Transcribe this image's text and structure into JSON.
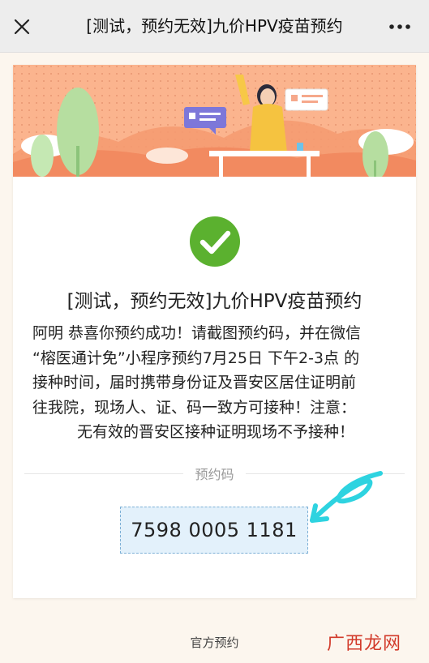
{
  "header": {
    "title": "[测试，预约无效]九价HPV疫苗预约",
    "close_icon": "close-icon",
    "more_icon": "more-dots-icon"
  },
  "card": {
    "heading": "[测试，预约无效]九价HPV疫苗预约",
    "message_lines": [
      "阿明 恭喜你预约成功！请截图预约码，并在微信",
      "“榕医通计免”小程序预约7月25日 下午2-3点 的",
      "接种时间，届时携带身份证及晋安区居住证明前",
      "往我院，现场人、证、码一致方可接种！注意：",
      "无有效的晋安区接种证明现场不予接种！"
    ],
    "code_label": "预约码",
    "code_value": "7598 0005 1181"
  },
  "footer": {
    "link": "官方预约"
  },
  "watermark": "广西龙网",
  "colors": {
    "banner": "#f9ae87",
    "check": "#5bb12f",
    "code_bg": "#e3f1fb",
    "squiggle": "#2ed3e0"
  }
}
